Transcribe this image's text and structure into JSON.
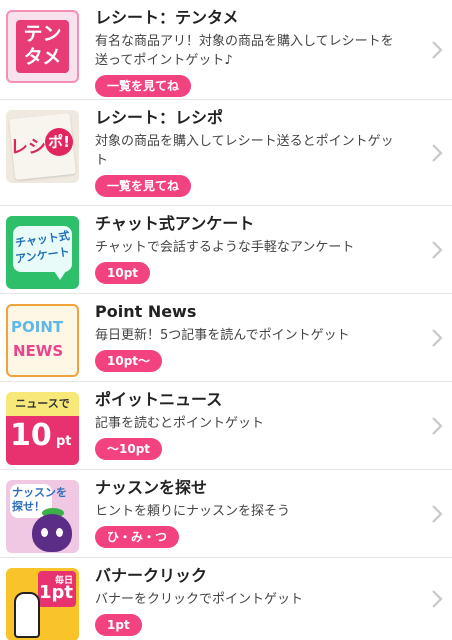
{
  "items": [
    {
      "title": "レシート：テンタメ",
      "desc_lines": [
        "有名な商品アリ！対象の商品を購入してレシートを",
        "送ってポイントゲット♪"
      ],
      "badge": "一覧を見てね",
      "thumb": {
        "lines": [
          "テン",
          "タメ"
        ]
      }
    },
    {
      "title": "レシート：レシポ",
      "desc_lines": [
        "対象の商品を購入してレシート送るとポイントゲッ",
        "ト"
      ],
      "badge": "一覧を見てね",
      "thumb": {
        "text": "レシ",
        "circle": "ポ!"
      }
    },
    {
      "title": "チャット式アンケート",
      "desc_lines": [
        "チャットで会話するような手軽なアンケート"
      ],
      "badge": "10pt",
      "thumb": {
        "lines": [
          "チャット式",
          "アンケート"
        ]
      }
    },
    {
      "title": "Point News",
      "desc_lines": [
        "毎日更新！5つ記事を読んでポイントゲット"
      ],
      "badge": "10pt〜",
      "thumb": {
        "line1": "POINT",
        "line2": "NEWS"
      }
    },
    {
      "title": "ポイットニュース",
      "desc_lines": [
        "記事を読むとポイントゲット"
      ],
      "badge": "〜10pt",
      "thumb": {
        "top": "ニュースで",
        "big": "10",
        "unit": "pt"
      }
    },
    {
      "title": "ナッスンを探せ",
      "desc_lines": [
        "ヒントを頼りにナッスンを探そう"
      ],
      "badge": "ひ・み・つ",
      "thumb": {
        "lines": [
          "ナッスンを",
          "探せ！"
        ]
      }
    },
    {
      "title": "バナークリック",
      "desc_lines": [
        "バナーをクリックでポイントゲット"
      ],
      "badge": "1pt",
      "thumb": {
        "small": "毎日",
        "big": "1pt"
      }
    }
  ],
  "colors": {
    "accent": "#f2427f",
    "divider": "#e6e6e6",
    "chevron": "#c8c8c8"
  },
  "icons": {
    "row_chevron": "chevron-right-icon"
  }
}
